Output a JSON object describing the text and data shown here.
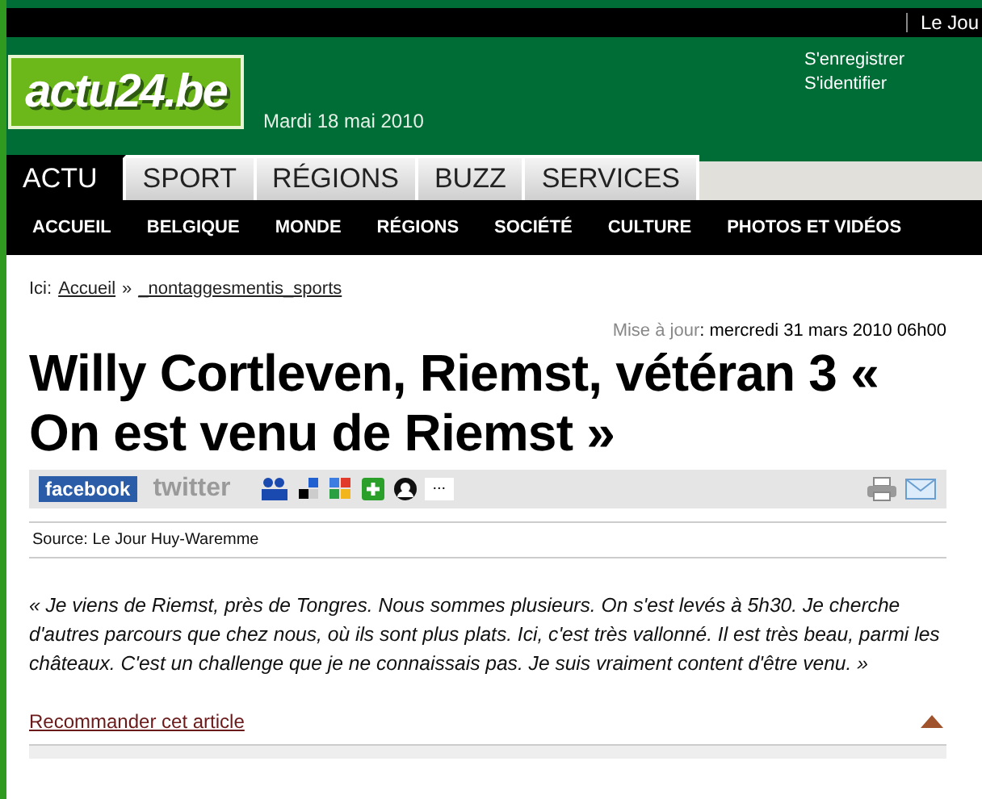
{
  "top_bar": {
    "link": "Le Jou"
  },
  "header": {
    "logo": "actu24.be",
    "date": "Mardi 18 mai 2010",
    "links": [
      "S'enregistrer",
      "S'identifier"
    ]
  },
  "tabs": [
    {
      "label": "ACTU",
      "selected": true
    },
    {
      "label": "SPORT",
      "selected": false
    },
    {
      "label": "RÉGIONS",
      "selected": false
    },
    {
      "label": "BUZZ",
      "selected": false
    },
    {
      "label": "SERVICES",
      "selected": false
    }
  ],
  "subnav": [
    "ACCUEIL",
    "BELGIQUE",
    "MONDE",
    "RÉGIONS",
    "SOCIÉTÉ",
    "CULTURE",
    "PHOTOS ET VIDÉOS"
  ],
  "breadcrumb": {
    "label": "Ici:",
    "items": [
      "Accueil",
      "_nontaggesmentis_sports"
    ],
    "separator": "»"
  },
  "article": {
    "updated_label": "Mise à jour",
    "updated": ": mercredi 31 mars 2010 06h00",
    "title": "Willy Cortleven, Riemst, vétéran 3 « On est venu de Riemst »",
    "share": {
      "facebook": "facebook",
      "twitter": "twitter",
      "more": "..."
    },
    "source": "Source: Le Jour Huy-Waremme",
    "body": "« Je viens de Riemst, près de Tongres. Nous sommes plusieurs. On s'est levés à 5h30. Je cherche d'autres parcours que chez nous, où ils sont plus plats. Ici, c'est très vallonné. Il est très beau, parmi les châteaux. C'est un challenge que je ne connaissais pas. Je suis vraiment content d'être venu. »",
    "recommend": "Recommander cet article"
  }
}
